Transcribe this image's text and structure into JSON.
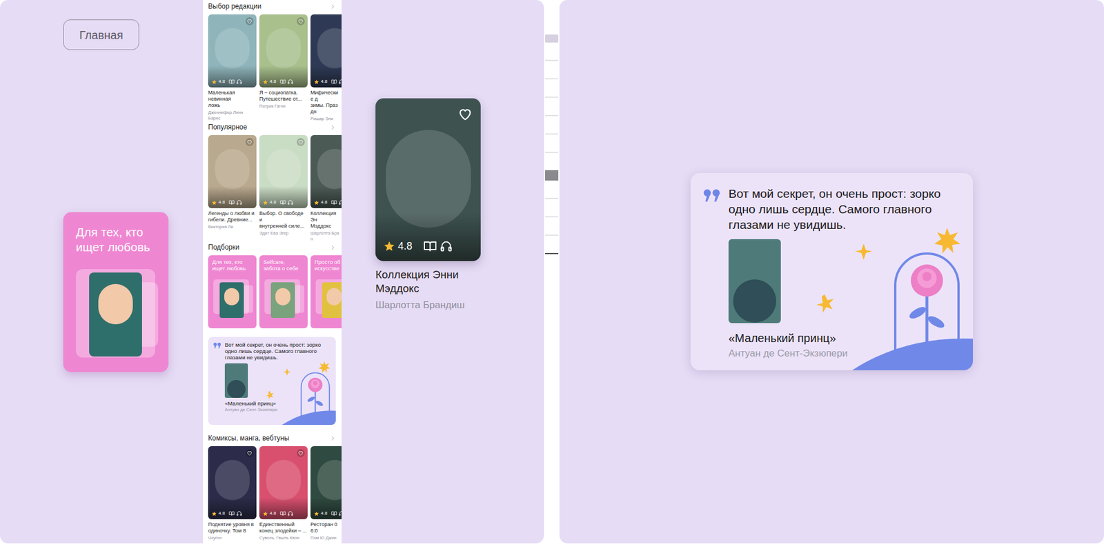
{
  "nav": {
    "home_button": "Главная"
  },
  "collection_card": {
    "title": "Для тех, кто ищет любовь"
  },
  "phone": {
    "sections": [
      {
        "kind": "books",
        "title": "Выбор редакции",
        "items": [
          {
            "title_lines": [
              "Маленькая невинная",
              "ложь"
            ],
            "author_lines": [
              "Дженнифер Линн",
              "Барнс"
            ],
            "rating": "4.8",
            "liked": false
          },
          {
            "title_lines": [
              "Я – социопатка.",
              "Путешествие от..."
            ],
            "author_lines": [
              "Патрик Гагни"
            ],
            "rating": "4.8",
            "liked": false
          },
          {
            "title_lines": [
              "Мифические д",
              "зимы. Праздн"
            ],
            "author_lines": [
              "Ришар Эли"
            ],
            "rating": "4.8",
            "liked": false
          }
        ]
      },
      {
        "kind": "books",
        "title": "Популярное",
        "items": [
          {
            "title_lines": [
              "Легенды о любви и",
              "гибели. Древние..."
            ],
            "author_lines": [
              "Виктория Ли"
            ],
            "rating": "4.8",
            "liked": false
          },
          {
            "title_lines": [
              "Выбор. О свободе и",
              "внутренней силе..."
            ],
            "author_lines": [
              "Эдит Ева Эгер"
            ],
            "rating": "4.8",
            "liked": false
          },
          {
            "title_lines": [
              "Коллекция Эн",
              "Мэддокс"
            ],
            "author_lines": [
              "Шарлотта Бран"
            ],
            "rating": "4.8",
            "liked": false
          }
        ]
      },
      {
        "kind": "collections",
        "title": "Подборки",
        "items": [
          {
            "title_lines": [
              "Для тех, кто",
              "ищет любовь"
            ]
          },
          {
            "title_lines": [
              "Selfcare,",
              "забота о себе"
            ]
          },
          {
            "title_lines": [
              "Просто об",
              "искусстве"
            ]
          }
        ]
      },
      {
        "kind": "quote",
        "quote": "Вот мой секрет, он очень прост: зорко одно лишь сердце. Самого главного глазами не увидишь.",
        "book_title": "«Маленький принц»",
        "author": "Антуан де Сент-Экзюпери"
      },
      {
        "kind": "books",
        "title": "Комиксы, манга, вебтуны",
        "items": [
          {
            "title_lines": [
              "Поднятие уровня в",
              "одиночку. Том 8"
            ],
            "author_lines": [
              "Чхугон"
            ],
            "rating": "4.8",
            "liked": false
          },
          {
            "title_lines": [
              "Единственный",
              "конец злодейки – ..."
            ],
            "author_lines": [
              "Суволь, Гвыль Квон"
            ],
            "rating": "4.8",
            "liked": false
          },
          {
            "title_lines": [
              "Ресторан 06:0"
            ],
            "author_lines": [
              "Пом Ю Джин"
            ],
            "rating": "4.8",
            "liked": false
          }
        ]
      }
    ]
  },
  "book_card": {
    "title": "Коллекция Энни Мэддокс",
    "author": "Шарлотта Брандиш",
    "rating": "4.8",
    "liked": false
  },
  "quote_card": {
    "quote": "Вот мой секрет, он очень прост: зорко одно лишь сердце. Самого главного глазами не увидишь.",
    "book_title": "«Маленький принц»",
    "author": "Антуан де Сент-Экзюпери"
  }
}
